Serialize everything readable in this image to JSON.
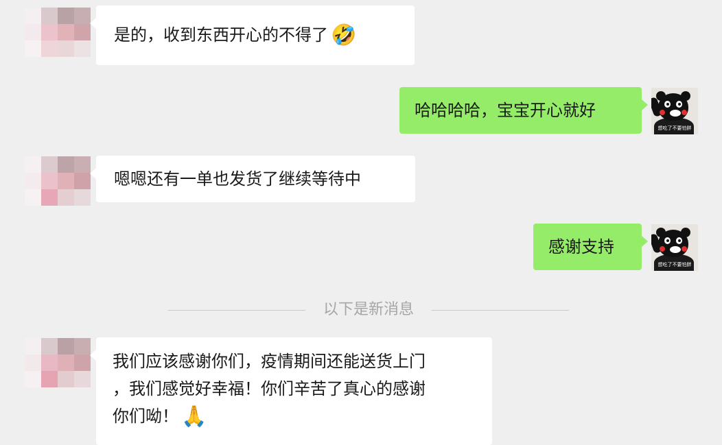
{
  "conversation": {
    "messages": [
      {
        "side": "left",
        "text": "是的，收到东西开心的不得了",
        "emoji": "🤣",
        "emoji_name": "laughing-face-icon"
      },
      {
        "side": "right",
        "text": "哈哈哈哈，宝宝开心就好"
      },
      {
        "side": "left",
        "text": "嗯嗯还有一单也发货了继续等待中"
      },
      {
        "side": "right",
        "text": "感谢支持"
      },
      {
        "side": "left",
        "lines": [
          "我们应该感谢你们，疫情期间还能送货上门",
          "，我们感觉好幸福！你们辛苦了真心的感谢",
          "你们呦！"
        ],
        "emoji": "🙏",
        "emoji_name": "praying-hands-icon"
      }
    ],
    "divider_text": "以下是新消息"
  },
  "avatars": {
    "contact": "pixelated-avatar",
    "self": "kumamon-sticker-avatar",
    "self_caption": "想吃了不要怕胖"
  },
  "colors": {
    "background": "#efefef",
    "bubble_incoming": "#ffffff",
    "bubble_outgoing": "#95ec69",
    "divider_text": "#a6a6a6"
  }
}
